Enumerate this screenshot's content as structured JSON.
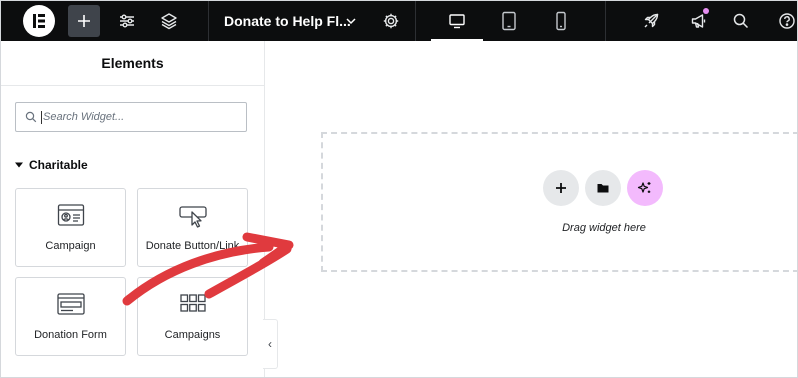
{
  "topbar": {
    "logo_icon": "elementor-logo-icon",
    "add_icon": "plus-icon",
    "settings_icon": "sliders-icon",
    "structure_icon": "layers-icon",
    "document_title": "Donate to Help Fl...",
    "document_chevron_icon": "chevron-down-icon",
    "page_settings_icon": "gear-icon",
    "devices": [
      {
        "name": "desktop",
        "icon": "desktop-icon",
        "active": true
      },
      {
        "name": "tablet",
        "icon": "tablet-icon",
        "active": false
      },
      {
        "name": "mobile",
        "icon": "mobile-icon",
        "active": false
      }
    ],
    "right_icons": [
      "rocket-icon",
      "megaphone-icon",
      "search-icon",
      "help-icon"
    ],
    "notification_color": "#e58ef0"
  },
  "panel": {
    "title": "Elements",
    "search_placeholder": "Search Widget...",
    "category": "Charitable",
    "widgets": [
      {
        "label": "Campaign",
        "icon": "campaign-card-icon"
      },
      {
        "label": "Donate Button/Link",
        "icon": "donate-button-cursor-icon"
      },
      {
        "label": "Donation Form",
        "icon": "donation-form-icon"
      },
      {
        "label": "Campaigns",
        "icon": "grid-icon"
      }
    ],
    "collapse_glyph": "‹"
  },
  "canvas": {
    "drop_text": "Drag widget here",
    "buttons": [
      {
        "icon": "plus-icon",
        "bg": "#e6e8ea"
      },
      {
        "icon": "folder-icon",
        "bg": "#e6e8ea"
      },
      {
        "icon": "ai-sparkle-icon",
        "bg": "#f3bafd"
      }
    ]
  },
  "annotation": {
    "color": "#e03a3e",
    "icon": "red-arrow-annotation"
  }
}
